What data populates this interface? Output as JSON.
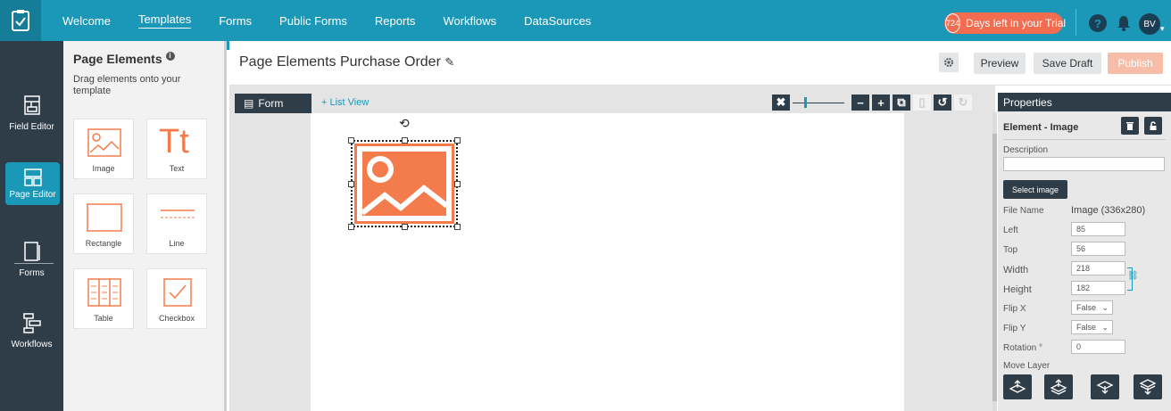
{
  "nav": {
    "items": [
      "Welcome",
      "Templates",
      "Forms",
      "Public Forms",
      "Reports",
      "Workflows",
      "DataSources"
    ],
    "active": "Templates",
    "trial_count": "724",
    "trial_text": "Days left in your Trial",
    "avatar": "BV"
  },
  "rail": {
    "items": [
      {
        "label": "Field Editor",
        "icon": "field-editor-icon"
      },
      {
        "label": "Page Editor",
        "icon": "page-editor-icon"
      },
      {
        "label": "Forms",
        "icon": "forms-icon"
      },
      {
        "label": "Workflows",
        "icon": "workflows-icon"
      }
    ],
    "active": "Page Editor"
  },
  "panel": {
    "title": "Page Elements",
    "subtitle": "Drag elements onto your template",
    "tiles": [
      "Image",
      "Text",
      "Rectangle",
      "Line",
      "Table",
      "Checkbox"
    ]
  },
  "header": {
    "title": "Page Elements Purchase Order",
    "preview": "Preview",
    "save_draft": "Save Draft",
    "publish": "Publish"
  },
  "canvas": {
    "form_tab": "Form",
    "list_view": "+ List View"
  },
  "props": {
    "heading": "Properties",
    "element_title": "Element - Image",
    "description_label": "Description",
    "description_value": "",
    "select_image": "Select image",
    "file_name_label": "File Name",
    "file_name_value": "Image (336x280)",
    "left_label": "Left",
    "left_value": "85",
    "top_label": "Top",
    "top_value": "56",
    "width_label": "Width",
    "width_value": "218",
    "height_label": "Height",
    "height_value": "182",
    "flipx_label": "Flip X",
    "flipx_value": "False",
    "flipy_label": "Flip Y",
    "flipy_value": "False",
    "rotation_label": "Rotation °",
    "rotation_value": "0",
    "move_layer_label": "Move Layer"
  },
  "colors": {
    "accent": "#1b98b8",
    "dark": "#2f3d48",
    "orange": "#f47c4c"
  }
}
